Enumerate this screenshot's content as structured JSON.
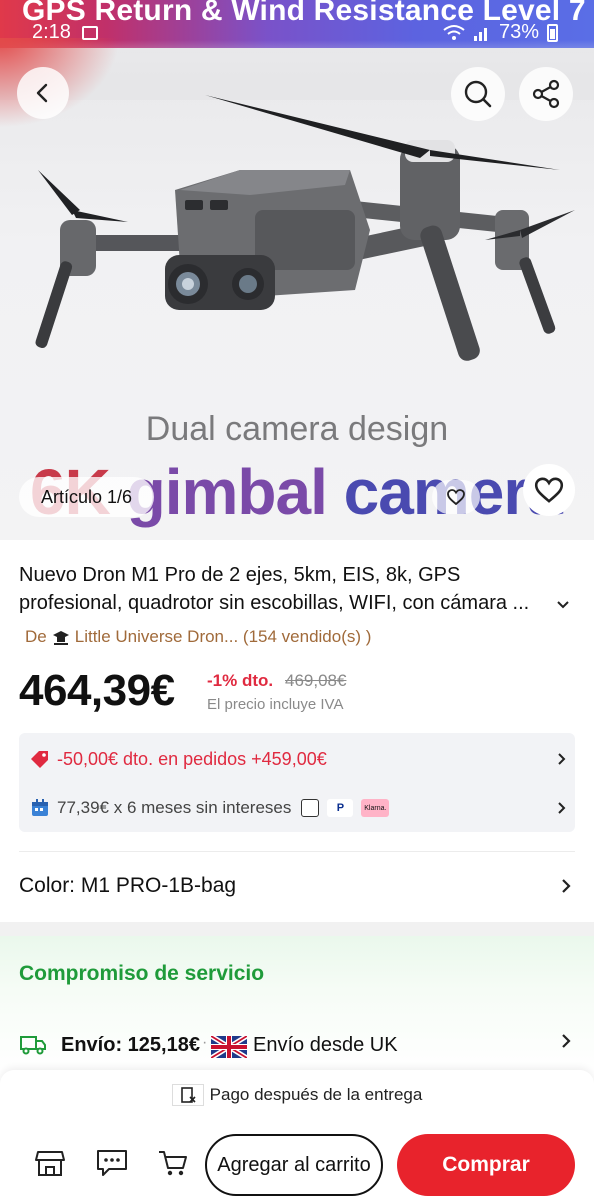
{
  "status_bar": {
    "time": "2:18",
    "battery": "73%"
  },
  "hero": {
    "banner_text": "GPS Return & Wind Resistance Level 7",
    "caption": "Dual camera design",
    "big_caption_part1": "6K ",
    "big_caption_part2": "gimbal ",
    "big_caption_part3": "camera",
    "counter": "Artículo 1/6"
  },
  "product": {
    "title_line1": "Nuevo Dron M1 Pro de 2 ejes, 5km, EIS, 8k, GPS",
    "title_line2": "profesional, quadrotor sin escobillas, WIFI, con cámara ...",
    "store_prefix": "De",
    "store_name": "Little Universe Dron... (154 vendido(s) )",
    "price": "464,39€",
    "discount": "-1% dto.",
    "old_price": "469,08€",
    "vat_note": "El precio incluye IVA"
  },
  "promo": {
    "coupon_text": "-50,00€ dto. en pedidos +459,00€",
    "installments_text": "77,39€ x 6 meses sin intereses",
    "klarna_label": "Klarna."
  },
  "color": {
    "label": "Color: M1 PRO-1B-bag"
  },
  "service": {
    "title": "Compromiso de servicio",
    "shipping_price": "Envío: 125,18€",
    "shipping_from": "Envío desde UK"
  },
  "bottom": {
    "pay_later": "Pago después de la entrega",
    "add_to_cart": "Agregar al carrito",
    "buy": "Comprar"
  },
  "colors": {
    "accent_red": "#e8232c",
    "discount_red": "#e02a40",
    "service_green": "#1f9b3a",
    "store_brown": "#a06a3a"
  },
  "icons": [
    "back-icon",
    "search-icon",
    "share-icon",
    "heart-icon",
    "chevron-down-icon",
    "coupon-icon",
    "calendar-icon",
    "chevron-right-icon",
    "truck-icon",
    "uk-flag-icon",
    "store-icon",
    "chat-icon",
    "cart-icon",
    "pay-later-icon"
  ]
}
